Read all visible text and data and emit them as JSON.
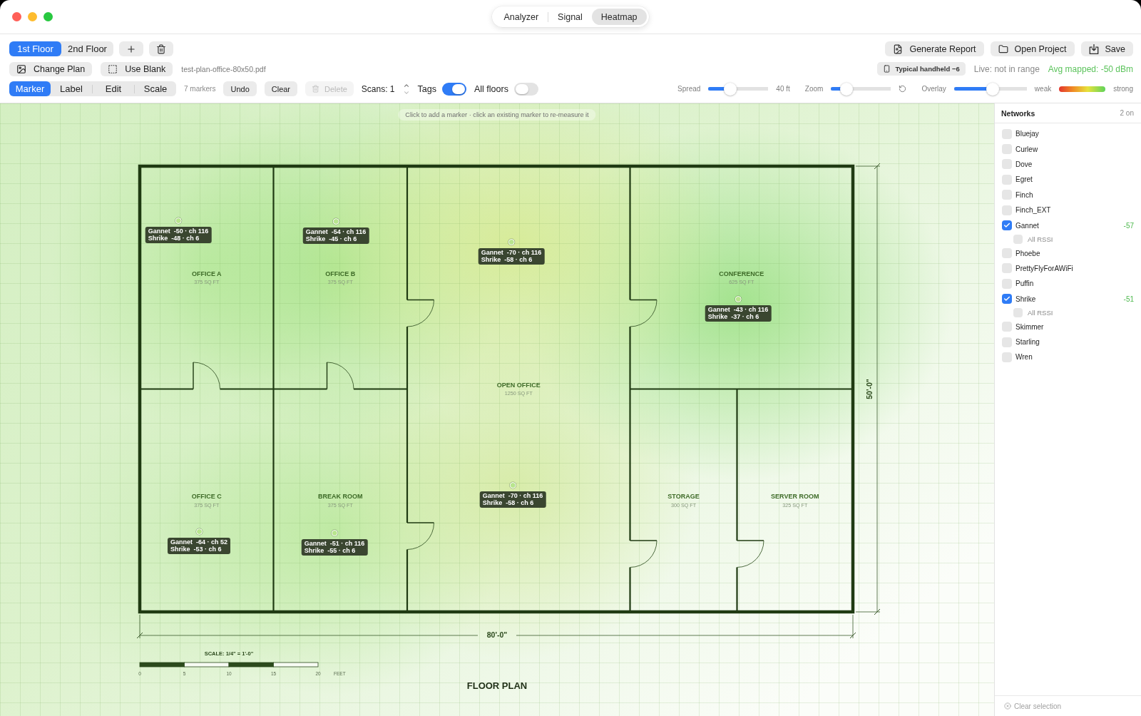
{
  "window": {
    "tabs": [
      {
        "label": "Analyzer",
        "selected": false
      },
      {
        "label": "Signal",
        "selected": false
      },
      {
        "label": "Heatmap",
        "selected": true
      }
    ]
  },
  "toolbar": {
    "floors": [
      {
        "label": "1st Floor",
        "selected": true
      },
      {
        "label": "2nd Floor",
        "selected": false
      }
    ],
    "plan_actions": [
      {
        "label": "Change Plan",
        "kind": "image"
      },
      {
        "label": "Use Blank",
        "kind": "blank"
      }
    ],
    "plan_file": "test-plan-office-80x50.pdf",
    "modes": [
      {
        "label": "Marker",
        "selected": true
      },
      {
        "label": "Label",
        "selected": false
      },
      {
        "label": "Edit",
        "selected": false
      },
      {
        "label": "Scale",
        "selected": false
      }
    ],
    "marker_count": "7 markers",
    "edit_actions": [
      {
        "label": "Undo",
        "kind": "plain",
        "disabled": false
      },
      {
        "label": "Clear",
        "kind": "plain",
        "disabled": false
      },
      {
        "label": "Delete",
        "kind": "trash",
        "disabled": true
      }
    ],
    "scans": "Scans: 1",
    "toggles": [
      {
        "label": "Tags",
        "on": true
      },
      {
        "label": "All floors",
        "on": false
      }
    ],
    "project_actions": [
      {
        "label": "Generate Report",
        "kind": "report"
      },
      {
        "label": "Open Project",
        "kind": "folder"
      },
      {
        "label": "Save",
        "kind": "save"
      }
    ],
    "device": "Typical handheld −6",
    "live_status": "Live: not in range",
    "avg_mapped": "Avg mapped: -50 dBm",
    "sliders": [
      {
        "label": "Spread",
        "level": 0.36,
        "reading": "40 ft"
      },
      {
        "label": "Zoom",
        "level": 0.26,
        "resettable": true
      },
      {
        "label": "Overlay",
        "level": 0.53
      }
    ],
    "legend": {
      "low": "weak",
      "high": "strong"
    }
  },
  "canvas": {
    "hint": "Click to add a marker · click an existing marker to re-measure it",
    "plan": {
      "rooms": [
        {
          "name": "OFFICE A",
          "area": "375 SQ FT"
        },
        {
          "name": "OFFICE B",
          "area": "375 SQ FT"
        },
        {
          "name": "CONFERENCE",
          "area": "625 SQ FT"
        },
        {
          "name": "OPEN OFFICE",
          "area": "1250 SQ FT"
        },
        {
          "name": "OFFICE C",
          "area": "375 SQ FT"
        },
        {
          "name": "BREAK ROOM",
          "area": "375 SQ FT"
        },
        {
          "name": "STORAGE",
          "area": "300 SQ FT"
        },
        {
          "name": "SERVER ROOM",
          "area": "325 SQ FT"
        }
      ],
      "width_label": "80'-0\"",
      "depth_label": "50'-0\"",
      "scale": {
        "title": "SCALE: 1/4\" = 1'-0\"",
        "ticks": [
          "0",
          "5",
          "10",
          "15",
          "20"
        ],
        "unit": "FEET"
      },
      "title": "FLOOR PLAN"
    },
    "markers": [
      {
        "lines": [
          "Gannet  -50 · ch 116",
          "Shrike  -48 · ch 6"
        ]
      },
      {
        "lines": [
          "Gannet  -54 · ch 116",
          "Shrike  -45 · ch 6"
        ]
      },
      {
        "lines": [
          "Gannet  -70 · ch 116",
          "Shrike  -58 · ch 6"
        ]
      },
      {
        "lines": [
          "Gannet  -43 · ch 116",
          "Shrike  -37 · ch 6"
        ]
      },
      {
        "lines": [
          "Gannet  -64 · ch 52",
          "Shrike  -53 · ch 6"
        ]
      },
      {
        "lines": [
          "Gannet  -51 · ch 116",
          "Shrike  -55 · ch 6"
        ]
      },
      {
        "lines": [
          "Gannet  -70 · ch 116",
          "Shrike  -58 · ch 6"
        ]
      }
    ]
  },
  "networks": {
    "title": "Networks",
    "count": "2 on",
    "items": [
      {
        "name": "Bluejay",
        "checked": false
      },
      {
        "name": "Curlew",
        "checked": false
      },
      {
        "name": "Dove",
        "checked": false
      },
      {
        "name": "Egret",
        "checked": false
      },
      {
        "name": "Finch",
        "checked": false
      },
      {
        "name": "Finch_EXT",
        "checked": false
      },
      {
        "name": "Gannet",
        "checked": true,
        "rssi": "-57",
        "all_rssi": {
          "label": "All RSSI",
          "checked": false
        }
      },
      {
        "name": "Phoebe",
        "checked": false
      },
      {
        "name": "PrettyFlyForAWiFi",
        "checked": false
      },
      {
        "name": "Puffin",
        "checked": false
      },
      {
        "name": "Shrike",
        "checked": true,
        "rssi": "-51",
        "all_rssi": {
          "label": "All RSSI",
          "checked": false
        }
      },
      {
        "name": "Skimmer",
        "checked": false
      },
      {
        "name": "Starling",
        "checked": false
      },
      {
        "name": "Wren",
        "checked": false
      }
    ],
    "footer": "Clear selection"
  }
}
